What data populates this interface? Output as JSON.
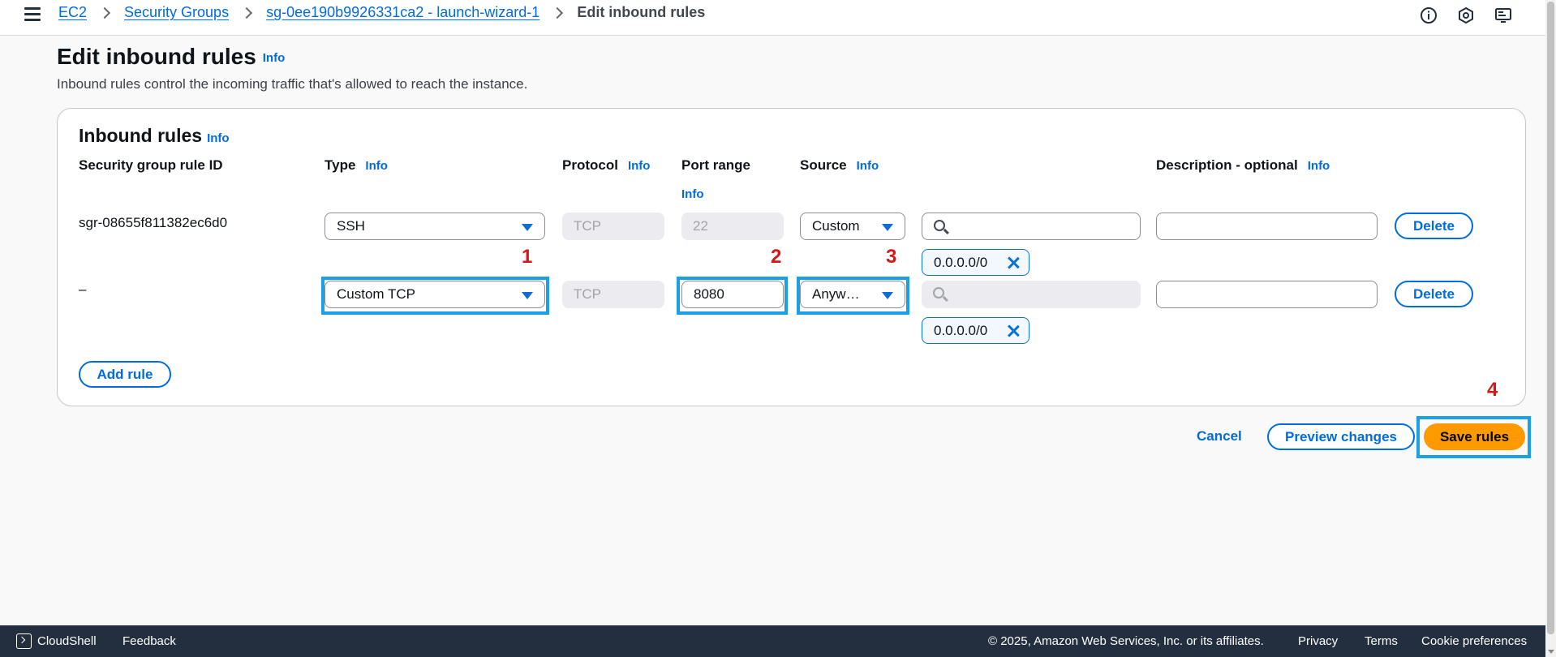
{
  "breadcrumb": {
    "items": [
      "EC2",
      "Security Groups",
      "sg-0ee190b9926331ca2 - launch-wizard-1"
    ],
    "current": "Edit inbound rules"
  },
  "top_icons": [
    "info-circle-icon",
    "settings-hexagon-icon",
    "display-monitor-icon"
  ],
  "header": {
    "title": "Edit inbound rules",
    "info": "Info",
    "description": "Inbound rules control the incoming traffic that's allowed to reach the instance."
  },
  "rules_panel": {
    "title": "Inbound rules",
    "info": "Info",
    "columns": {
      "rule_id": "Security group rule ID",
      "type": "Type",
      "protocol": "Protocol",
      "port_range": "Port range",
      "source": "Source",
      "description": "Description - optional"
    },
    "info_label": "Info",
    "rows": [
      {
        "rule_id": "sgr-08655f811382ec6d0",
        "type": "SSH",
        "protocol": "TCP",
        "port_range": "22",
        "source": "Custom",
        "cidr_token": "0.0.0.0/0",
        "description": "",
        "delete_label": "Delete"
      },
      {
        "rule_id": "–",
        "type": "Custom TCP",
        "protocol": "TCP",
        "port_range": "8080",
        "source": "Anyw…",
        "cidr_token": "0.0.0.0/0",
        "description": "",
        "delete_label": "Delete"
      }
    ],
    "add_rule_label": "Add rule"
  },
  "actions": {
    "cancel": "Cancel",
    "preview": "Preview changes",
    "save": "Save rules"
  },
  "annotations": [
    "1",
    "2",
    "3",
    "4"
  ],
  "colors": {
    "accent": "#006ce0",
    "primary_button": "#ff9900",
    "highlight_box": "#1aa0e6",
    "annotation_number": "#d91515",
    "footer_bg": "#232f3e"
  },
  "footer": {
    "cloudshell": "CloudShell",
    "feedback": "Feedback",
    "copyright": "© 2025, Amazon Web Services, Inc. or its affiliates.",
    "privacy": "Privacy",
    "terms": "Terms",
    "cookies": "Cookie preferences"
  }
}
